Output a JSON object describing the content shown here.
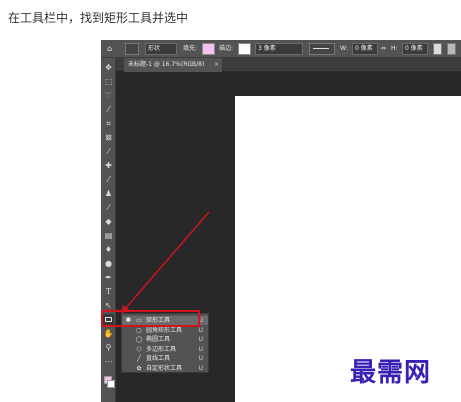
{
  "caption": "在工具栏中，找到矩形工具并选中",
  "options_bar": {
    "mode": "形状",
    "fill_label": "填充:",
    "stroke_label": "描边:",
    "stroke_width": "3 像素",
    "width_label": "W:",
    "width_value": "0 像素",
    "link_symbol": "⇔",
    "height_label": "H:",
    "height_value": "0 像素"
  },
  "document_tab": {
    "label": "未标题-1 @ 16.7%(RGB/8)",
    "close": "×"
  },
  "flyout": {
    "items": [
      {
        "label": "矩形工具",
        "key": "U",
        "icon": "▭",
        "active": true
      },
      {
        "label": "圆角矩形工具",
        "key": "U",
        "icon": "▢",
        "active": false
      },
      {
        "label": "椭圆工具",
        "key": "U",
        "icon": "◯",
        "active": false
      },
      {
        "label": "多边形工具",
        "key": "U",
        "icon": "⬡",
        "active": false
      },
      {
        "label": "直线工具",
        "key": "U",
        "icon": "╱",
        "active": false
      },
      {
        "label": "自定形状工具",
        "key": "U",
        "icon": "✿",
        "active": false
      }
    ]
  },
  "watermark": "最需网",
  "colors": {
    "highlight": "#d4141c",
    "foreground": "#f4c2ec",
    "background": "#ffffff",
    "watermark": "#3a1fb5"
  }
}
